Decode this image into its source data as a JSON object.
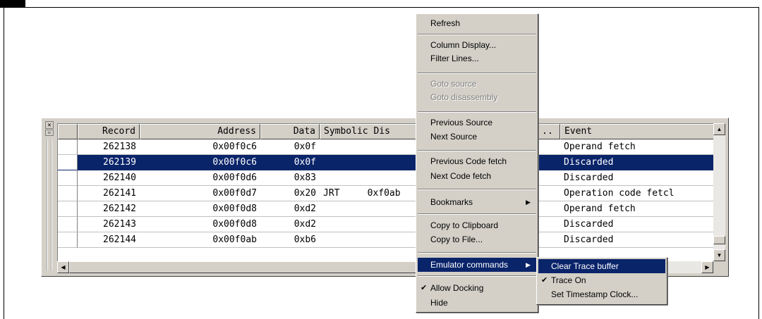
{
  "trace_window": {
    "dock_close_label": "✕",
    "columns": [
      "Record",
      "Address",
      "Data",
      "Symbolic Dis",
      "..",
      "Event"
    ],
    "rows": [
      {
        "record": "262138",
        "address": "0x00f0c6",
        "data": "0x0f",
        "symbolic": "",
        "event": "Operand fetch",
        "selected": false
      },
      {
        "record": "262139",
        "address": "0x00f0c6",
        "data": "0x0f",
        "symbolic": "",
        "event": "Discarded",
        "selected": true
      },
      {
        "record": "262140",
        "address": "0x00f0d6",
        "data": "0x83",
        "symbolic": "",
        "event": "Discarded",
        "selected": false
      },
      {
        "record": "262141",
        "address": "0x00f0d7",
        "data": "0x20",
        "symbolic": "JRT     0xf0ab",
        "event": "Operation code fetcl",
        "selected": false
      },
      {
        "record": "262142",
        "address": "0x00f0d8",
        "data": "0xd2",
        "symbolic": "",
        "event": "Operand fetch",
        "selected": false
      },
      {
        "record": "262143",
        "address": "0x00f0d8",
        "data": "0xd2",
        "symbolic": "",
        "event": "Discarded",
        "selected": false
      },
      {
        "record": "262144",
        "address": "0x00f0ab",
        "data": "0xb6",
        "symbolic": "",
        "event": "Discarded",
        "selected": false
      }
    ]
  },
  "context_menu": {
    "refresh": "Refresh",
    "column_display": "Column Display...",
    "filter_lines": "Filter Lines...",
    "goto_source": "Goto source",
    "goto_disassembly": "Goto disassembly",
    "previous_source": "Previous Source",
    "next_source": "Next Source",
    "previous_code_fetch": "Previous Code fetch",
    "next_code_fetch": "Next Code fetch",
    "bookmarks": "Bookmarks",
    "copy_to_clipboard": "Copy to Clipboard",
    "copy_to_file": "Copy to File...",
    "emulator_commands": "Emulator commands",
    "allow_docking": "Allow Docking",
    "hide": "Hide",
    "check_glyph": "✔",
    "arrow_glyph": "▶"
  },
  "emulator_submenu": {
    "clear_trace_buffer": "Clear Trace buffer",
    "trace_on": "Trace On",
    "set_timestamp_clock": "Set Timestamp Clock..."
  },
  "colors": {
    "selection": "#0a246a",
    "face": "#d4d0c8"
  }
}
